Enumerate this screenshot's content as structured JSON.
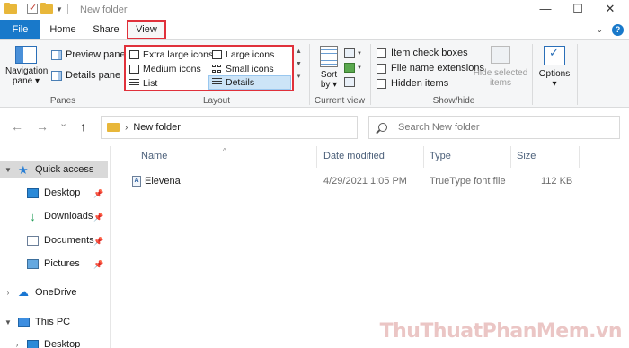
{
  "window": {
    "title": "New folder",
    "controls": {
      "minimize": "—",
      "maximize": "☐",
      "close": "✕"
    }
  },
  "tabs": {
    "file": "File",
    "home": "Home",
    "share": "Share",
    "view": "View"
  },
  "ribbon": {
    "panes": {
      "navigation_pane": "Navigation pane ▾",
      "preview_pane": "Preview pane",
      "details_pane": "Details pane",
      "group_label": "Panes"
    },
    "layout": {
      "extra_large_icons": "Extra large icons",
      "large_icons": "Large icons",
      "medium_icons": "Medium icons",
      "small_icons": "Small icons",
      "list": "List",
      "details": "Details",
      "selected": "Details",
      "group_label": "Layout"
    },
    "current_view": {
      "sort_by": "Sort by ▾",
      "group_label": "Current view"
    },
    "show_hide": {
      "item_check_boxes": "Item check boxes",
      "file_name_extensions": "File name extensions",
      "hidden_items": "Hidden items",
      "hide_selected_items": "Hide selected items",
      "group_label": "Show/hide"
    },
    "options": {
      "label": "Options ▾"
    }
  },
  "address": {
    "back": "←",
    "forward": "→",
    "recent": "⌄",
    "up": "↑",
    "path": "New folder",
    "refresh": "↻",
    "search_placeholder": "Search New folder"
  },
  "nav_tree": {
    "quick_access": "Quick access",
    "desktop": "Desktop",
    "downloads": "Downloads",
    "documents": "Documents",
    "pictures": "Pictures",
    "onedrive": "OneDrive",
    "this_pc": "This PC",
    "desktop_pc": "Desktop"
  },
  "file_list": {
    "columns": {
      "name": "Name",
      "date": "Date modified",
      "type": "Type",
      "size": "Size"
    },
    "rows": [
      {
        "name": "Elevena",
        "date": "4/29/2021 1:05 PM",
        "type": "TrueType font file",
        "size": "112 KB"
      }
    ]
  },
  "watermark": "ThuThuatPhanMem.vn"
}
